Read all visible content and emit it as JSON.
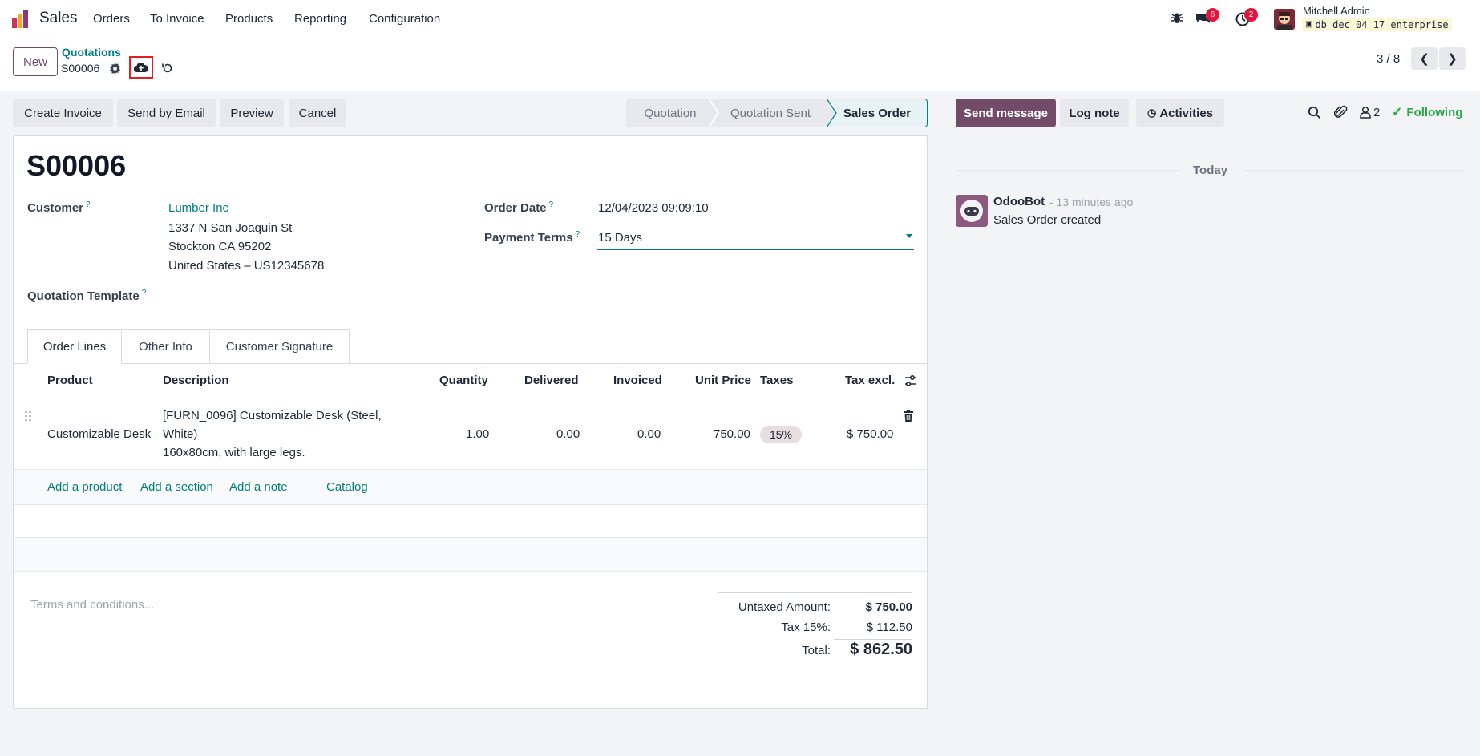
{
  "navbar": {
    "app_name": "Sales",
    "menu": [
      "Orders",
      "To Invoice",
      "Products",
      "Reporting",
      "Configuration"
    ],
    "messages_badge": "6",
    "activities_badge": "2",
    "user_name": "Mitchell Admin",
    "database": "db_dec_04_17_enterprise"
  },
  "control": {
    "new_label": "New",
    "breadcrumb_parent": "Quotations",
    "record_name": "S00006",
    "pager": "3 / 8"
  },
  "actions": {
    "create_invoice": "Create Invoice",
    "send_by_email": "Send by Email",
    "preview": "Preview",
    "cancel": "Cancel"
  },
  "statusbar": {
    "stages": [
      "Quotation",
      "Quotation Sent",
      "Sales Order"
    ],
    "active": "Sales Order"
  },
  "form": {
    "title": "S00006",
    "customer_label": "Customer",
    "customer_name": "Lumber Inc",
    "address_line1": "1337 N San Joaquin St",
    "address_line2": "Stockton CA 95202",
    "address_line3": "United States – US12345678",
    "order_date_label": "Order Date",
    "order_date": "12/04/2023 09:09:10",
    "payment_terms_label": "Payment Terms",
    "payment_terms": "15 Days",
    "quotation_template_label": "Quotation Template",
    "help_marker": "?"
  },
  "tabs": [
    "Order Lines",
    "Other Info",
    "Customer Signature"
  ],
  "order_lines": {
    "columns": [
      "Product",
      "Description",
      "Quantity",
      "Delivered",
      "Invoiced",
      "Unit Price",
      "Taxes",
      "Tax excl."
    ],
    "rows": [
      {
        "product": "Customizable Desk",
        "description_1": "[FURN_0096] Customizable Desk (Steel,",
        "description_2": "White)",
        "description_3": "160x80cm, with large legs.",
        "quantity": "1.00",
        "delivered": "0.00",
        "invoiced": "0.00",
        "unit_price": "750.00",
        "taxes": "15%",
        "subtotal": "$ 750.00"
      }
    ],
    "add_product": "Add a product",
    "add_section": "Add a section",
    "add_note": "Add a note",
    "catalog": "Catalog"
  },
  "footer": {
    "terms_placeholder": "Terms and conditions...",
    "untaxed_label": "Untaxed Amount:",
    "untaxed_value": "$ 750.00",
    "tax_label": "Tax 15%:",
    "tax_value": "$ 112.50",
    "total_label": "Total:",
    "total_value": "$ 862.50"
  },
  "chatter": {
    "send_message": "Send message",
    "log_note": "Log note",
    "activities": "Activities",
    "followers_count": "2",
    "following": "Following",
    "date_separator": "Today",
    "message_author": "OdooBot",
    "message_time": "- 13 minutes ago",
    "message_body": "Sales Order created"
  },
  "colors": {
    "brand": "#714b67",
    "link": "#017e84",
    "badge": "#e1163c",
    "highlight_box": "#e02020"
  }
}
